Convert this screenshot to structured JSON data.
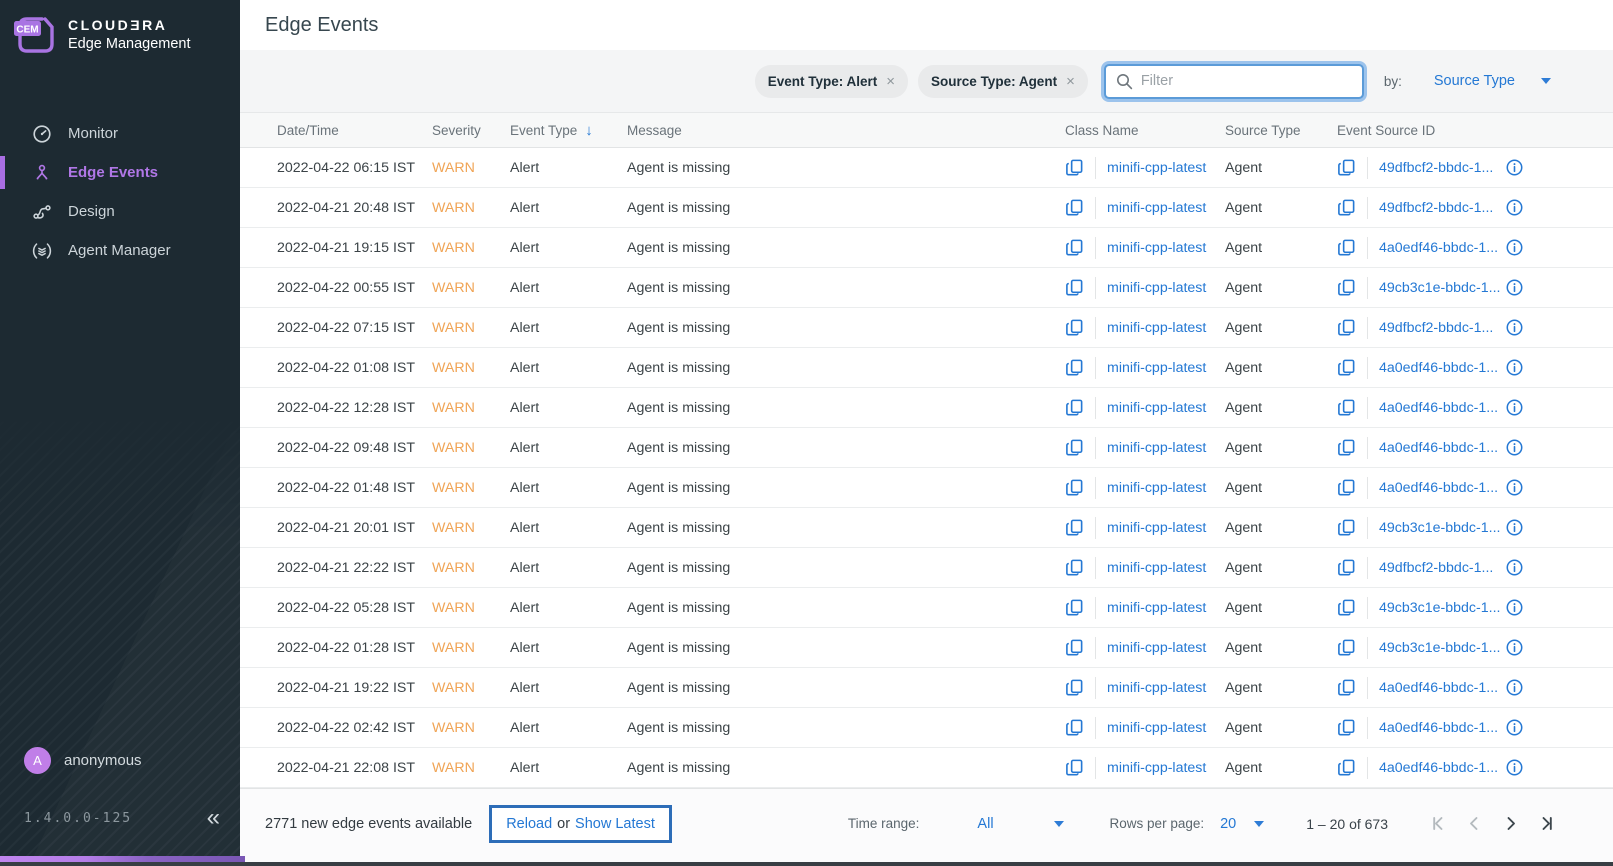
{
  "colors": {
    "accent_purple": "#a974e3",
    "link_blue": "#2478d4",
    "warn_orange": "#f0a455",
    "sidebar_bg": "#1d2a32",
    "focus_ring": "#9cc3ec"
  },
  "sidebar": {
    "logo": {
      "badge": "CEM",
      "brand": "CLOUDƎRA",
      "product": "Edge Management"
    },
    "items": [
      {
        "label": "Monitor",
        "icon": "gauge-icon",
        "active": false
      },
      {
        "label": "Edge Events",
        "icon": "edge-node-icon",
        "active": true
      },
      {
        "label": "Design",
        "icon": "flow-design-icon",
        "active": false
      },
      {
        "label": "Agent Manager",
        "icon": "agent-manager-icon",
        "active": false
      }
    ],
    "user": {
      "avatar_initial": "A",
      "name": "anonymous"
    },
    "version": "1.4.0.0-125",
    "collapse_glyph": "«"
  },
  "header": {
    "title": "Edge Events"
  },
  "filters": {
    "chips": [
      {
        "label": "Event Type: Alert",
        "close_glyph": "×"
      },
      {
        "label": "Source Type: Agent",
        "close_glyph": "×"
      }
    ],
    "search": {
      "placeholder": "Filter"
    },
    "by_label": "by:",
    "by_value": "Source Type"
  },
  "table": {
    "columns": {
      "datetime": "Date/Time",
      "severity": "Severity",
      "event_type": "Event Type",
      "message": "Message",
      "class_name": "Class Name",
      "source_type": "Source Type",
      "event_source_id": "Event Source ID"
    },
    "sort": {
      "column": "Event Type",
      "direction": "desc",
      "glyph": "↓"
    },
    "rows": [
      {
        "datetime": "2022-04-22 06:15 IST",
        "severity": "WARN",
        "event_type": "Alert",
        "message": "Agent is missing",
        "class_name": "minifi-cpp-latest",
        "source_type": "Agent",
        "event_source_id": "49dfbcf2-bbdc-1..."
      },
      {
        "datetime": "2022-04-21 20:48 IST",
        "severity": "WARN",
        "event_type": "Alert",
        "message": "Agent is missing",
        "class_name": "minifi-cpp-latest",
        "source_type": "Agent",
        "event_source_id": "49dfbcf2-bbdc-1..."
      },
      {
        "datetime": "2022-04-21 19:15 IST",
        "severity": "WARN",
        "event_type": "Alert",
        "message": "Agent is missing",
        "class_name": "minifi-cpp-latest",
        "source_type": "Agent",
        "event_source_id": "4a0edf46-bbdc-1..."
      },
      {
        "datetime": "2022-04-22 00:55 IST",
        "severity": "WARN",
        "event_type": "Alert",
        "message": "Agent is missing",
        "class_name": "minifi-cpp-latest",
        "source_type": "Agent",
        "event_source_id": "49cb3c1e-bbdc-1..."
      },
      {
        "datetime": "2022-04-22 07:15 IST",
        "severity": "WARN",
        "event_type": "Alert",
        "message": "Agent is missing",
        "class_name": "minifi-cpp-latest",
        "source_type": "Agent",
        "event_source_id": "49dfbcf2-bbdc-1..."
      },
      {
        "datetime": "2022-04-22 01:08 IST",
        "severity": "WARN",
        "event_type": "Alert",
        "message": "Agent is missing",
        "class_name": "minifi-cpp-latest",
        "source_type": "Agent",
        "event_source_id": "4a0edf46-bbdc-1..."
      },
      {
        "datetime": "2022-04-22 12:28 IST",
        "severity": "WARN",
        "event_type": "Alert",
        "message": "Agent is missing",
        "class_name": "minifi-cpp-latest",
        "source_type": "Agent",
        "event_source_id": "4a0edf46-bbdc-1..."
      },
      {
        "datetime": "2022-04-22 09:48 IST",
        "severity": "WARN",
        "event_type": "Alert",
        "message": "Agent is missing",
        "class_name": "minifi-cpp-latest",
        "source_type": "Agent",
        "event_source_id": "4a0edf46-bbdc-1..."
      },
      {
        "datetime": "2022-04-22 01:48 IST",
        "severity": "WARN",
        "event_type": "Alert",
        "message": "Agent is missing",
        "class_name": "minifi-cpp-latest",
        "source_type": "Agent",
        "event_source_id": "4a0edf46-bbdc-1..."
      },
      {
        "datetime": "2022-04-21 20:01 IST",
        "severity": "WARN",
        "event_type": "Alert",
        "message": "Agent is missing",
        "class_name": "minifi-cpp-latest",
        "source_type": "Agent",
        "event_source_id": "49cb3c1e-bbdc-1..."
      },
      {
        "datetime": "2022-04-21 22:22 IST",
        "severity": "WARN",
        "event_type": "Alert",
        "message": "Agent is missing",
        "class_name": "minifi-cpp-latest",
        "source_type": "Agent",
        "event_source_id": "49dfbcf2-bbdc-1..."
      },
      {
        "datetime": "2022-04-22 05:28 IST",
        "severity": "WARN",
        "event_type": "Alert",
        "message": "Agent is missing",
        "class_name": "minifi-cpp-latest",
        "source_type": "Agent",
        "event_source_id": "49cb3c1e-bbdc-1..."
      },
      {
        "datetime": "2022-04-22 01:28 IST",
        "severity": "WARN",
        "event_type": "Alert",
        "message": "Agent is missing",
        "class_name": "minifi-cpp-latest",
        "source_type": "Agent",
        "event_source_id": "49cb3c1e-bbdc-1..."
      },
      {
        "datetime": "2022-04-21 19:22 IST",
        "severity": "WARN",
        "event_type": "Alert",
        "message": "Agent is missing",
        "class_name": "minifi-cpp-latest",
        "source_type": "Agent",
        "event_source_id": "4a0edf46-bbdc-1..."
      },
      {
        "datetime": "2022-04-22 02:42 IST",
        "severity": "WARN",
        "event_type": "Alert",
        "message": "Agent is missing",
        "class_name": "minifi-cpp-latest",
        "source_type": "Agent",
        "event_source_id": "4a0edf46-bbdc-1..."
      },
      {
        "datetime": "2022-04-21 22:08 IST",
        "severity": "WARN",
        "event_type": "Alert",
        "message": "Agent is missing",
        "class_name": "minifi-cpp-latest",
        "source_type": "Agent",
        "event_source_id": "4a0edf46-bbdc-1..."
      }
    ]
  },
  "footer": {
    "new_events_text": "2771 new edge events available",
    "reload_label": "Reload",
    "or_label": "or",
    "show_latest_label": "Show Latest",
    "time_range_label": "Time range:",
    "time_range_value": "All",
    "rows_per_page_label": "Rows per page:",
    "rows_per_page_value": "20",
    "range_text": "1 – 20 of 673"
  }
}
